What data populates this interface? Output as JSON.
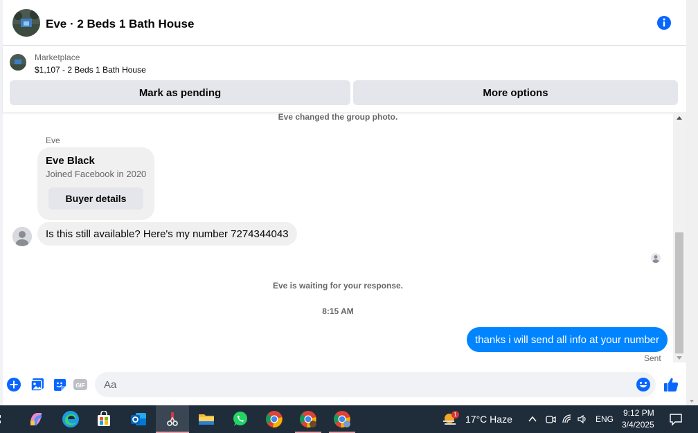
{
  "header": {
    "title": "Eve · 2 Beds 1 Bath House",
    "info_icon": "info-icon"
  },
  "marketplace": {
    "label": "Marketplace",
    "listing": "$1,107 - 2 Beds 1 Bath House",
    "mark_pending": "Mark as pending",
    "more_options": "More options"
  },
  "messages": {
    "system_changed_photo": "Eve changed the group photo.",
    "sender_name": "Eve",
    "card": {
      "name": "Eve Black",
      "subtitle": "Joined Facebook in 2020",
      "button": "Buyer details"
    },
    "incoming": "Is this still available? Here's my number 7274344043",
    "waiting": "Eve is waiting for your response.",
    "timestamp": "8:15 AM",
    "outgoing": "thanks i will send all info at your number",
    "status": "Sent"
  },
  "composer": {
    "placeholder": "Aa",
    "icons": [
      "plus-icon",
      "photo-icon",
      "sticker-icon",
      "gif-icon",
      "emoji-icon",
      "like-icon"
    ],
    "gif_label": "GIF"
  },
  "taskbar": {
    "weather": "17°C  Haze",
    "weather_badge": "1",
    "language": "ENG",
    "time": "9:12 PM",
    "date": "3/4/2025"
  },
  "colors": {
    "accent": "#0084ff",
    "bubble_in": "#f0f0f0",
    "taskbar": "#1f2c3a"
  }
}
